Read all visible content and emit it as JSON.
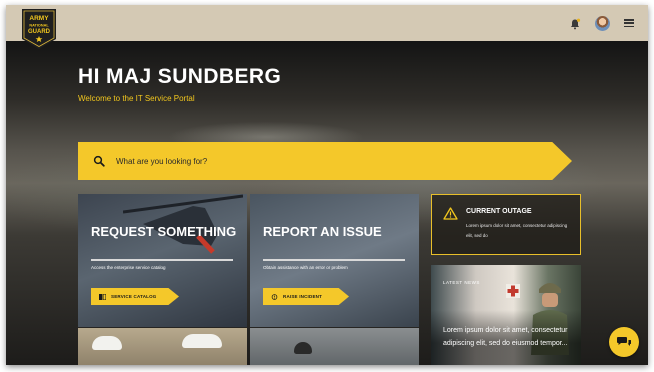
{
  "header": {
    "logo_text": [
      "ARMY",
      "NATIONAL",
      "GUARD"
    ],
    "notification_icon": "bell-icon",
    "avatar_icon": "user-avatar",
    "menu_icon": "hamburger-menu-icon"
  },
  "hero": {
    "greeting": "HI MAJ SUNDBERG",
    "subtitle": "Welcome to the IT Service Portal"
  },
  "search": {
    "placeholder": "What are you looking for?",
    "icon": "search-icon"
  },
  "cards": [
    {
      "title": "REQUEST SOMETHING",
      "description": "Access the enterprise service catalog",
      "button_label": "SERVICE CATALOG",
      "button_icon": "catalog-icon"
    },
    {
      "title": "REPORT AN ISSUE",
      "description": "Obtain assistance with an error or problem",
      "button_label": "RAISE INCIDENT",
      "button_icon": "alert-circle-icon"
    }
  ],
  "outage": {
    "title": "CURRENT OUTAGE",
    "body": "Lorem ipsum dolor sit amet, consectetur adipiscing elit, sed do",
    "icon": "warning-triangle-icon"
  },
  "news": {
    "label": "LATEST NEWS",
    "text": "Lorem ipsum dolor sit amet, consectetur adipiscing elit, sed do eiusmod tempor..."
  },
  "colors": {
    "accent_yellow": "#F4C82A",
    "topbar": "#D4C9B4",
    "logo_dark": "#1F1F1F"
  },
  "chat": {
    "icon": "chat-bubbles-icon"
  }
}
